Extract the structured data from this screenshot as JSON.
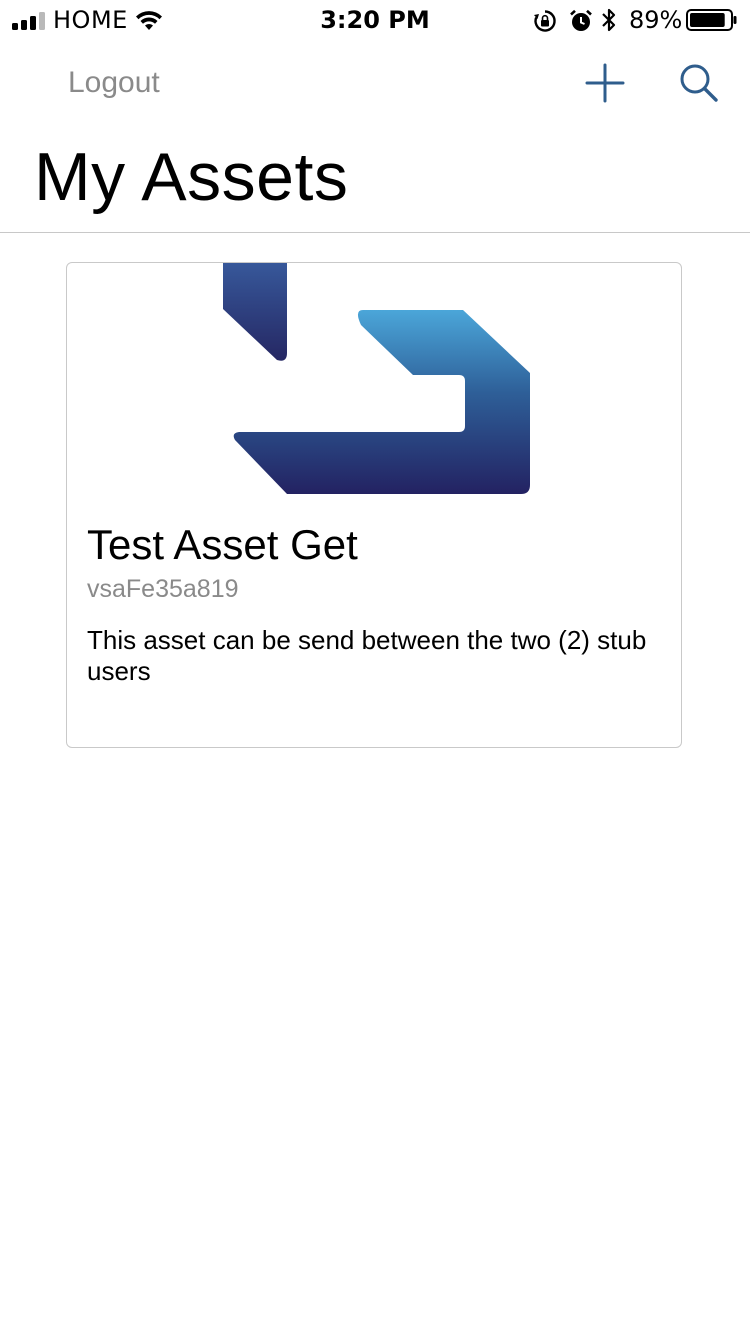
{
  "status_bar": {
    "carrier": "HOME",
    "time": "3:20 PM",
    "battery_percent": "89%",
    "battery_level": 0.89,
    "signal_bars": 3,
    "icons": [
      "signal-icon",
      "wifi-icon",
      "rotation-lock-icon",
      "alarm-icon",
      "bluetooth-icon",
      "battery-icon"
    ]
  },
  "nav": {
    "logout_label": "Logout",
    "add_icon": "plus-icon",
    "search_icon": "search-icon",
    "accent_color": "#2f5d8c"
  },
  "page": {
    "title": "My Assets"
  },
  "assets": [
    {
      "name": "Test Asset Get",
      "id": "vsaFe35a819",
      "description": "This asset can be send between the two (2) stub users",
      "image": "asset-logo-icon"
    }
  ]
}
